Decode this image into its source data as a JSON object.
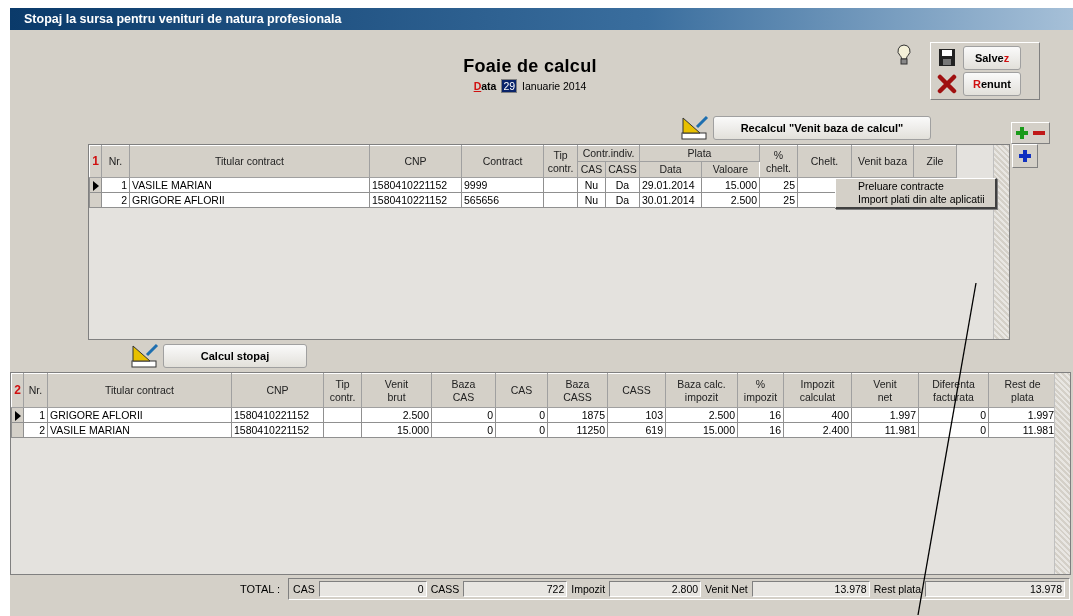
{
  "window": {
    "title": "Stopaj la sursa pentru venituri de natura profesionala"
  },
  "heading": "Foaie de calcul",
  "date": {
    "key": "D",
    "rest": "ata",
    "day": "29",
    "month_year": "Ianuarie 2014"
  },
  "buttons": [
    {
      "before": "Salve",
      "key": "z",
      "kind": "save"
    },
    {
      "key": "R",
      "after": "enunt",
      "kind": "cancel"
    }
  ],
  "recalc_button": "Recalcul \"Venit baza de calcul\"",
  "contracts": {
    "marker": "1",
    "columns": [
      {
        "label": "Nr."
      },
      {
        "label": "Titular contract"
      },
      {
        "label": "CNP"
      },
      {
        "label": "Contract"
      },
      {
        "label": "Tip\ncontr."
      },
      {
        "label": "CAS",
        "group_start": true
      },
      {
        "label": "CASS",
        "in_group": true
      },
      {
        "label": "Data",
        "group_start": true
      },
      {
        "label": "Valoare",
        "in_group": true
      },
      {
        "label": "%\nchelt."
      },
      {
        "label": "Chelt."
      },
      {
        "label": "Venit baza"
      },
      {
        "label": "Zile"
      }
    ],
    "column_groups": [
      {
        "label": "Contr.indiv."
      },
      {
        "label": "Plata"
      }
    ],
    "rows": [
      {
        "current": true,
        "cells": [
          "1",
          "VASILE MARIAN",
          "1580410221152",
          "9999",
          null,
          "Nu",
          "Da",
          "29.01.2014",
          "15.000",
          "25",
          null,
          null,
          null
        ]
      },
      {
        "current": false,
        "cells": [
          "2",
          "GRIGORE AFLORII",
          "1580410221152",
          "565656",
          null,
          "Nu",
          "Da",
          "30.01.2014",
          "2.500",
          "25",
          null,
          null,
          null
        ]
      }
    ]
  },
  "context_menu": [
    "Preluare contracte",
    "Import plati din alte aplicatii"
  ],
  "calc_button": "Calcul stopaj",
  "results": {
    "marker": "2",
    "columns": [
      {
        "label": "Nr."
      },
      {
        "label": "Titular contract"
      },
      {
        "label": "CNP"
      },
      {
        "label": "Tip\ncontr."
      },
      {
        "label": "Venit\nbrut"
      },
      {
        "label": "Baza\nCAS"
      },
      {
        "label": "CAS"
      },
      {
        "label": "Baza\nCASS"
      },
      {
        "label": "CASS"
      },
      {
        "label": "Baza calc.\nimpozit"
      },
      {
        "label": "%\nimpozit"
      },
      {
        "label": "Impozit\ncalculat"
      },
      {
        "label": "Venit\nnet"
      },
      {
        "label": "Diferenta\nfacturata"
      },
      {
        "label": "Rest de\nplata"
      }
    ],
    "rows": [
      {
        "current": true,
        "cells": [
          "1",
          "GRIGORE AFLORII",
          "1580410221152",
          null,
          "2.500",
          "0",
          "0",
          "1875",
          "103",
          "2.500",
          "16",
          "400",
          "1.997",
          "0",
          "1.997"
        ]
      },
      {
        "current": false,
        "cells": [
          "2",
          "VASILE MARIAN",
          "1580410221152",
          null,
          "15.000",
          "0",
          "0",
          "11250",
          "619",
          "15.000",
          "16",
          "2.400",
          "11.981",
          "0",
          "11.981"
        ]
      }
    ]
  },
  "totals": {
    "label": "TOTAL :",
    "fields": [
      {
        "label": "CAS",
        "value": "0"
      },
      {
        "label": "CASS",
        "value": "722"
      },
      {
        "label": "Impozit",
        "value": "2.800"
      },
      {
        "label": "Venit Net",
        "value": "13.978"
      },
      {
        "label": "Rest plata",
        "value": "13.978"
      }
    ]
  }
}
